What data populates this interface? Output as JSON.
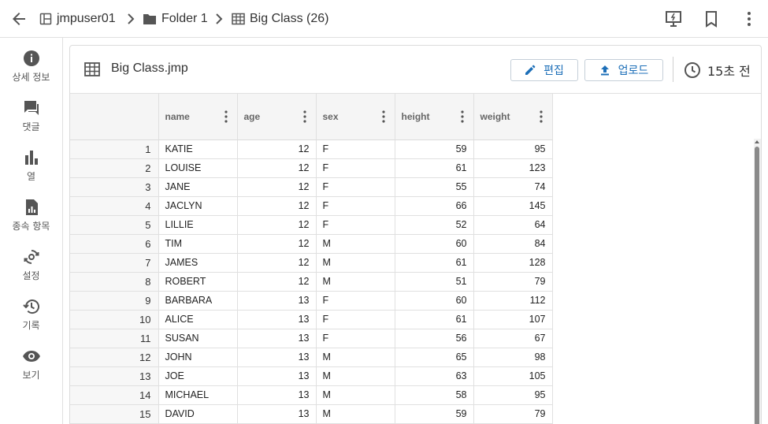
{
  "topbar": {
    "breadcrumbs": [
      {
        "label": "jmpuser01",
        "icon": "workspace-icon"
      },
      {
        "label": "Folder 1",
        "icon": "folder-icon"
      },
      {
        "label": "Big Class (26)",
        "icon": "table-icon"
      }
    ],
    "actions": [
      "present-icon",
      "bookmark-icon",
      "more-vert-icon"
    ]
  },
  "sidenav": {
    "items": [
      {
        "label": "상세 정보",
        "icon": "info-icon"
      },
      {
        "label": "댓글",
        "icon": "comment-icon"
      },
      {
        "label": "열",
        "icon": "bar-chart-icon"
      },
      {
        "label": "종속 항목",
        "icon": "dependency-file-icon"
      },
      {
        "label": "설정",
        "icon": "settings-sync-icon"
      },
      {
        "label": "기록",
        "icon": "history-icon"
      },
      {
        "label": "보기",
        "icon": "eye-icon"
      }
    ]
  },
  "panel": {
    "file_title": "Big Class.jmp",
    "edit_label": "편집",
    "upload_label": "업로드",
    "timestamp": "15초 전"
  },
  "table": {
    "columns": [
      "name",
      "age",
      "sex",
      "height",
      "weight"
    ],
    "rows": [
      {
        "n": "1",
        "cells": [
          "KATIE",
          "12",
          "F",
          "59",
          "95"
        ]
      },
      {
        "n": "2",
        "cells": [
          "LOUISE",
          "12",
          "F",
          "61",
          "123"
        ]
      },
      {
        "n": "3",
        "cells": [
          "JANE",
          "12",
          "F",
          "55",
          "74"
        ]
      },
      {
        "n": "4",
        "cells": [
          "JACLYN",
          "12",
          "F",
          "66",
          "145"
        ]
      },
      {
        "n": "5",
        "cells": [
          "LILLIE",
          "12",
          "F",
          "52",
          "64"
        ]
      },
      {
        "n": "6",
        "cells": [
          "TIM",
          "12",
          "M",
          "60",
          "84"
        ]
      },
      {
        "n": "7",
        "cells": [
          "JAMES",
          "12",
          "M",
          "61",
          "128"
        ]
      },
      {
        "n": "8",
        "cells": [
          "ROBERT",
          "12",
          "M",
          "51",
          "79"
        ]
      },
      {
        "n": "9",
        "cells": [
          "BARBARA",
          "13",
          "F",
          "60",
          "112"
        ]
      },
      {
        "n": "10",
        "cells": [
          "ALICE",
          "13",
          "F",
          "61",
          "107"
        ]
      },
      {
        "n": "11",
        "cells": [
          "SUSAN",
          "13",
          "F",
          "56",
          "67"
        ]
      },
      {
        "n": "12",
        "cells": [
          "JOHN",
          "13",
          "M",
          "65",
          "98"
        ]
      },
      {
        "n": "13",
        "cells": [
          "JOE",
          "13",
          "M",
          "63",
          "105"
        ]
      },
      {
        "n": "14",
        "cells": [
          "MICHAEL",
          "13",
          "M",
          "58",
          "95"
        ]
      },
      {
        "n": "15",
        "cells": [
          "DAVID",
          "13",
          "M",
          "59",
          "79"
        ]
      }
    ]
  },
  "colors": {
    "accent": "#1d6fb8",
    "icon": "#555555",
    "border": "#e0e0e0"
  }
}
